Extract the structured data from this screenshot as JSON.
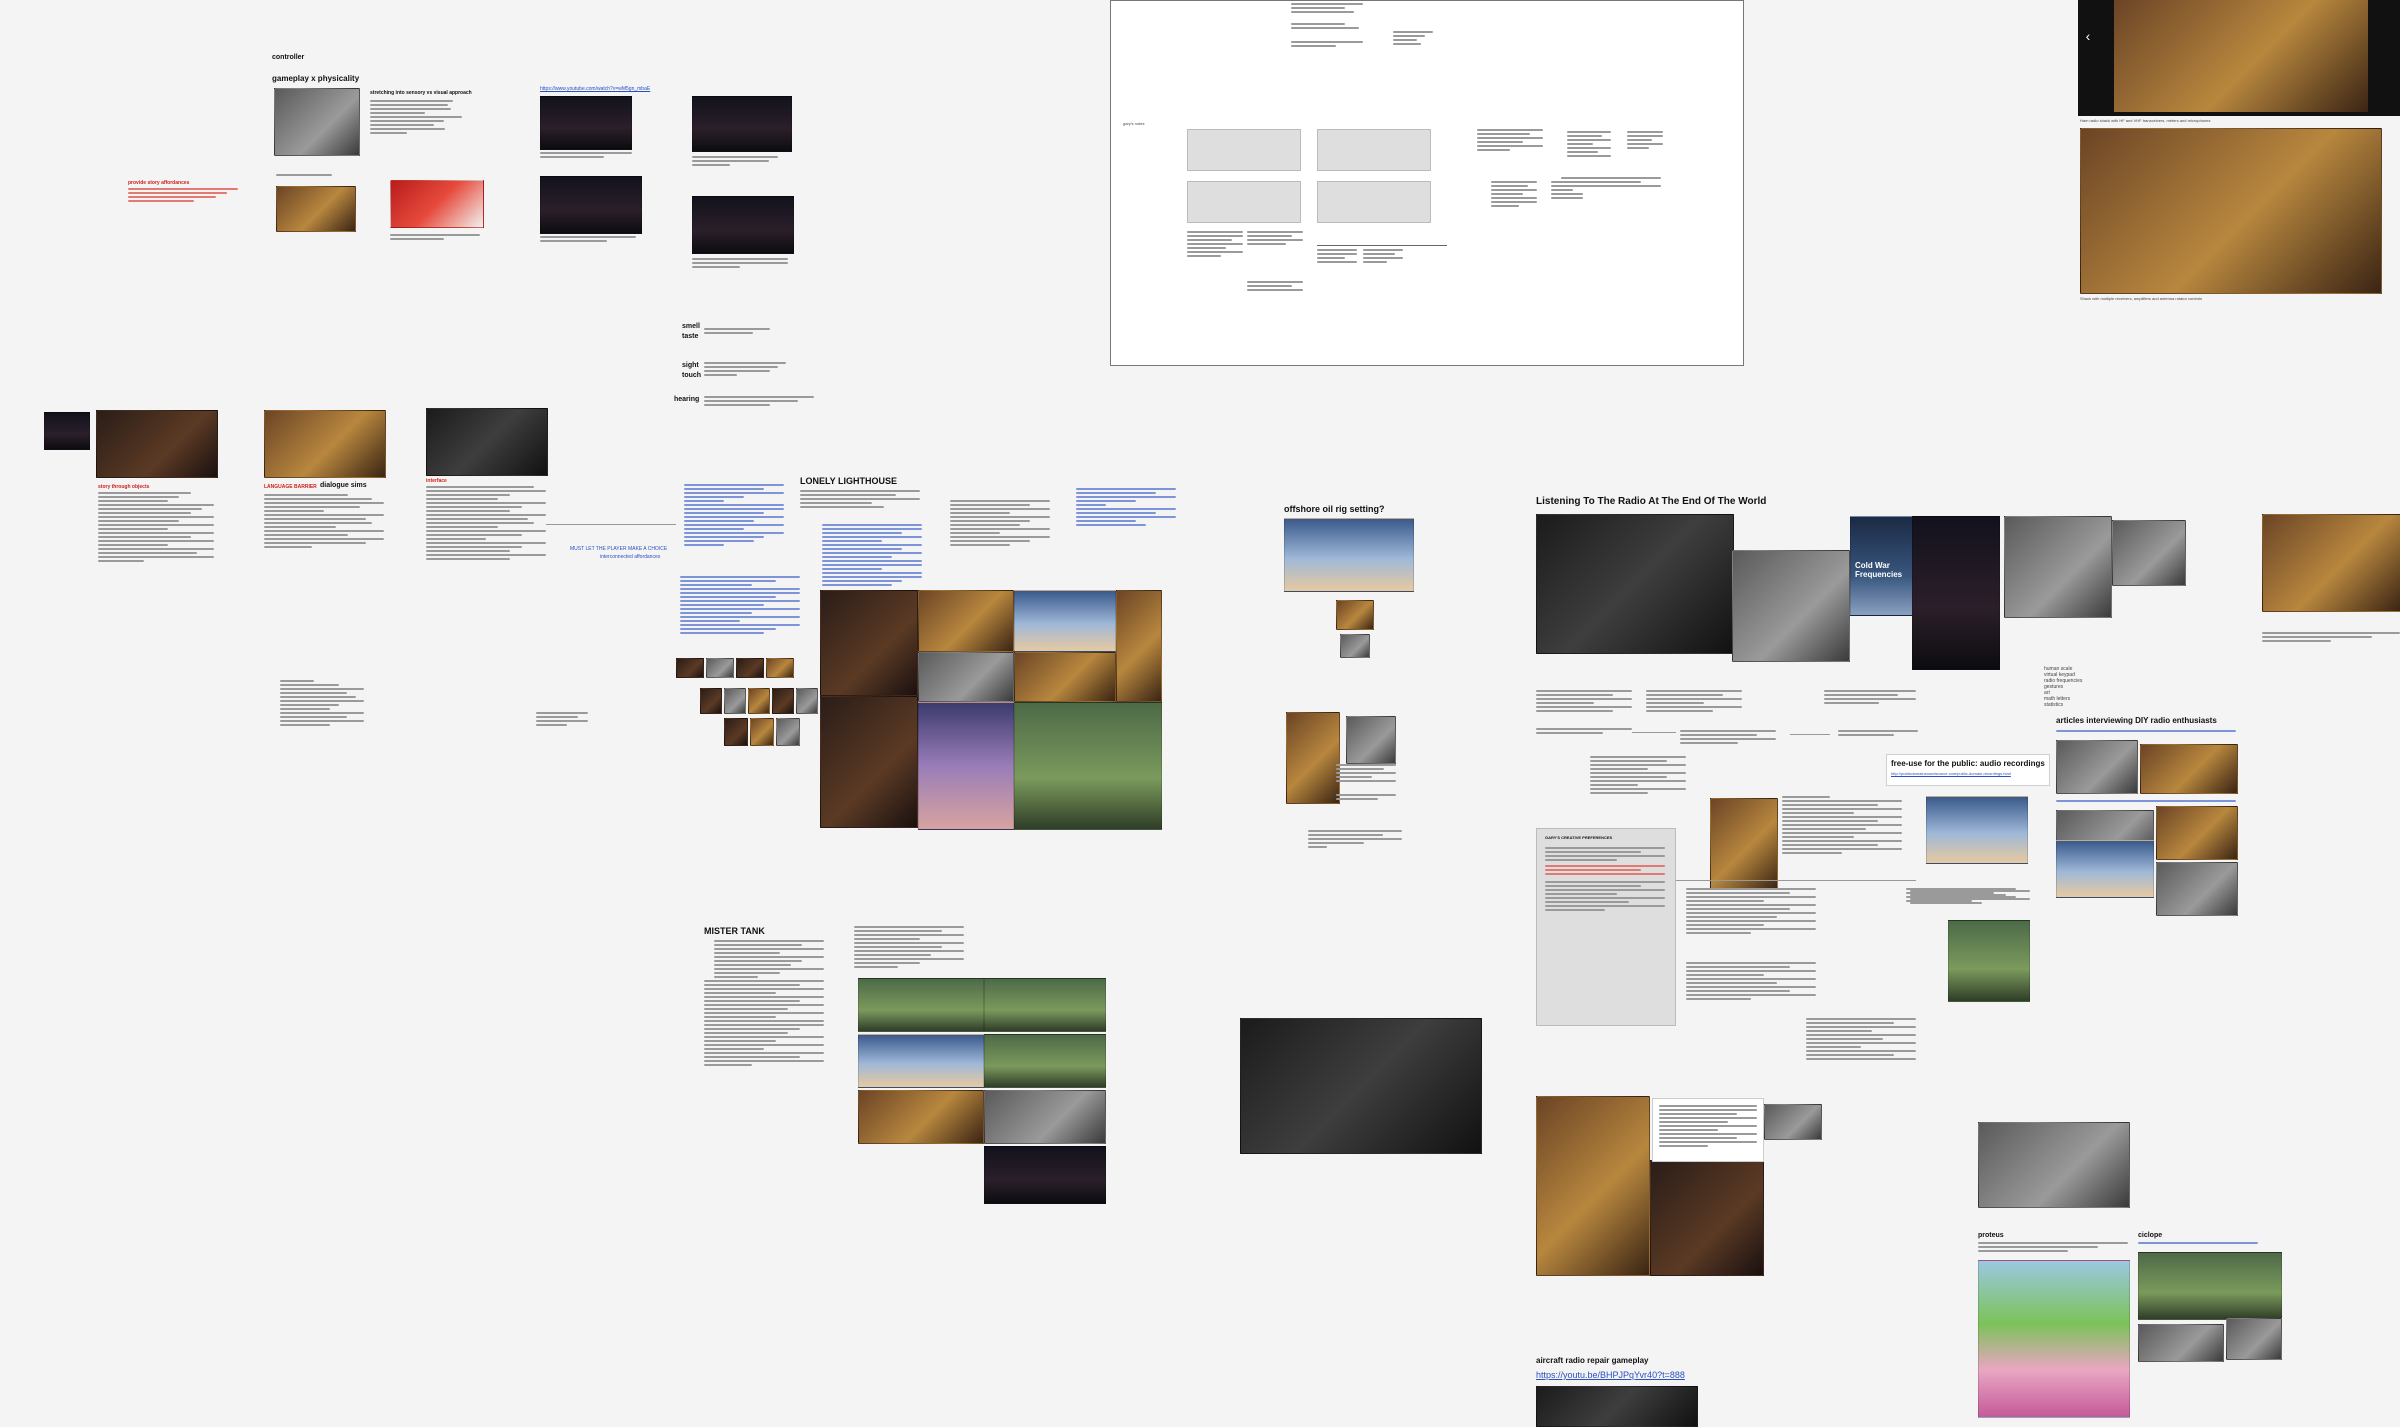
{
  "sections": {
    "controller": "controller",
    "gameplay_physicality": "gameplay x physicality",
    "lonely_lighthouse": "LONELY LIGHTHOUSE",
    "offshore": "offshore oil rig setting?",
    "listening": "Listening To The Radio At The End Of The World",
    "mister_tank": "MISTER TANK",
    "articles": "articles interviewing DIY radio enthusiasts",
    "free_use": "free-use for the public: audio recordings",
    "aircraft": "aircraft radio repair gameplay",
    "proteus": "proteus",
    "ciclope": "ciclope"
  },
  "senses": {
    "smell": "smell",
    "taste": "taste",
    "sight": "sight",
    "touch": "touch",
    "hearing": "hearing"
  },
  "labels": {
    "stretching": "stretching into sensory vs visual approach",
    "provide_affordances": "provide story affordances",
    "story_objects": "story through objects",
    "language_barrier": "LANGUAGE BARRIER",
    "dialogue_sims": "dialogue sims",
    "interface": "interface",
    "cold_war": "Cold War Frequencies",
    "youtube_url": "https://www.youtube.com/watch?v=wM5gn_mbaE",
    "aircraft_url": "https://youtu.be/BHPJPqYvr40?t=888",
    "free_use_url": "http://publicdomainsoundsource.com/public-domain-recordings.html",
    "gaps_pref": "GARY'S CREATIVE PREFERENCES",
    "garys_notes": "gary's notes",
    "must_be_solved": "MUST LET THE PLAYER MAKE A CHOICE",
    "interconnect": "interconnected affordances"
  },
  "gallery": {
    "prev_icon": "‹",
    "caption_top": "Ham radio shack with HF and VHF transceivers, meters and microphones",
    "caption_bottom": "Shack with multiple receivers, amplifiers and antenna rotator controls"
  },
  "side_list": [
    "human scale",
    "virtual keypad",
    "radio frequencies",
    "gestures",
    "art",
    "math letters",
    "statistics"
  ]
}
